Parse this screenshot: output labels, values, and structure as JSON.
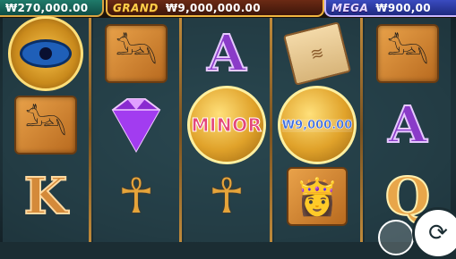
{
  "jackpots": {
    "minor_value": "₩270,000.00",
    "grand_label": "GRAND",
    "grand_value": "₩9,000,000.00",
    "mega_label": "MEGA",
    "mega_value": "₩900,00"
  },
  "reels": {
    "row1": [
      "eye-of-horus",
      "anubis",
      "letter-A",
      "scroll",
      "anubis"
    ],
    "row2": [
      "anubis",
      "purple-gem",
      "minor-coin",
      "coin-value",
      "letter-A"
    ],
    "row3": [
      "letter-K",
      "ankh",
      "ankh",
      "cleopatra",
      "letter-Q"
    ],
    "minor_coin_label": "MINOR",
    "coin_value_label": "₩9,000.00",
    "letter_a": "A",
    "letter_k": "K",
    "letter_q": "Q"
  },
  "icons": {
    "eye": "eye-of-horus-icon",
    "anubis": "anubis-icon",
    "scroll": "scroll-icon",
    "gem": "gem-icon",
    "coin": "coin-icon",
    "ankh": "ankh-icon",
    "queen": "cleopatra-icon",
    "spin": "spin-icon"
  },
  "colors": {
    "frame_gold": "#c08a3a",
    "grand_gold": "#ffcf4a",
    "mega_blue": "#3a4bc0",
    "minor_pink": "#e4487a"
  }
}
